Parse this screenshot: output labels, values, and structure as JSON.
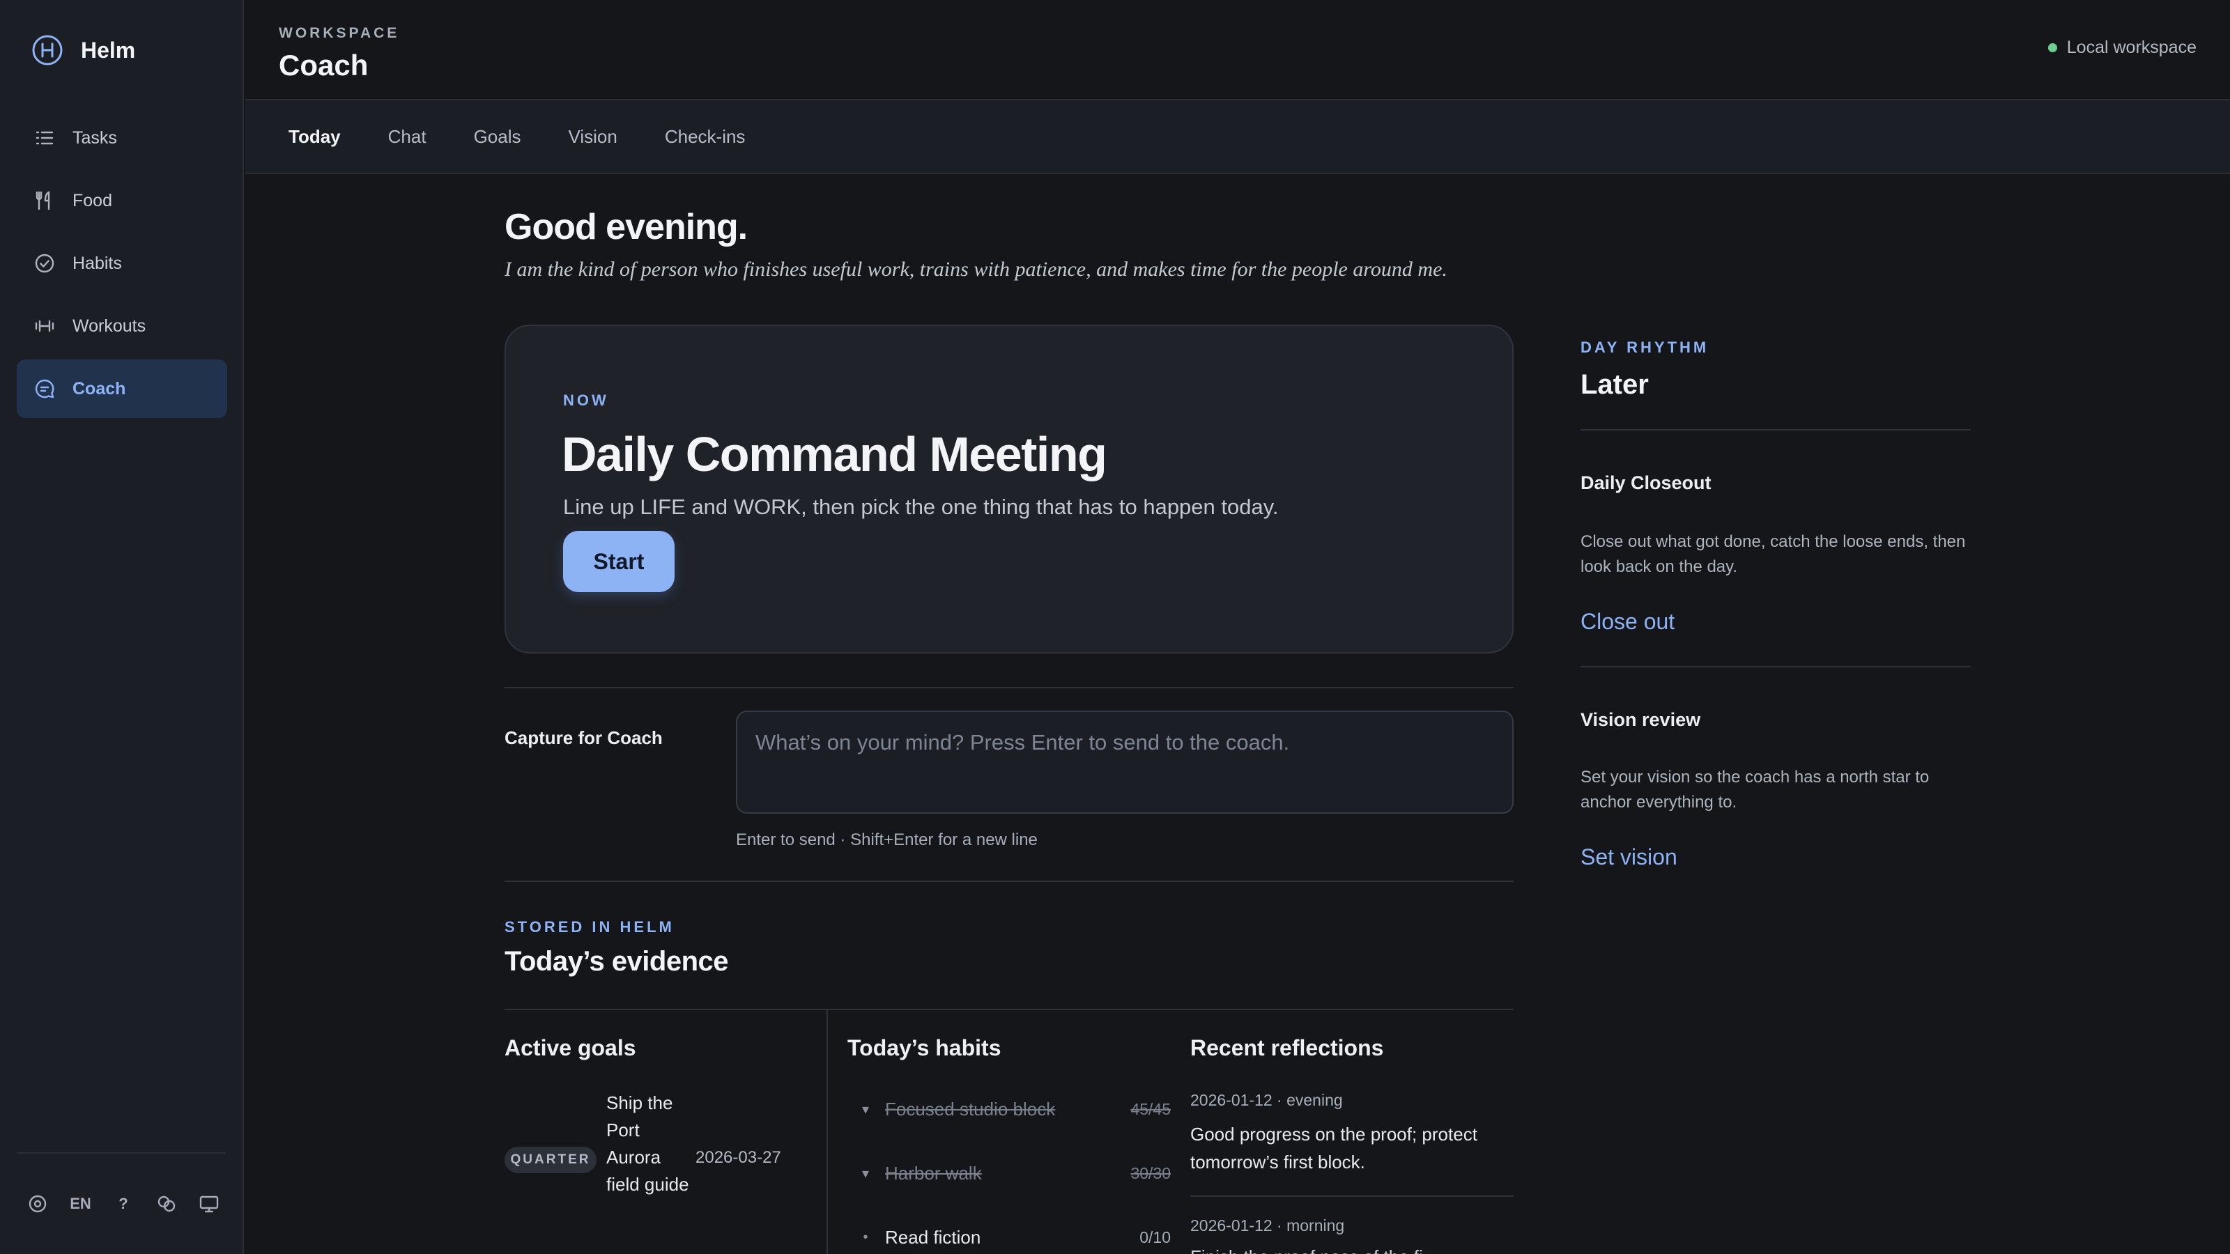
{
  "app": {
    "name": "Helm"
  },
  "sidebar": {
    "items": [
      {
        "label": "Tasks",
        "icon": "list-icon"
      },
      {
        "label": "Food",
        "icon": "fork-knife-icon"
      },
      {
        "label": "Habits",
        "icon": "check-circle-icon"
      },
      {
        "label": "Workouts",
        "icon": "dumbbell-icon"
      },
      {
        "label": "Coach",
        "icon": "chat-bubble-icon",
        "active": true
      }
    ],
    "footer": {
      "language": "EN",
      "help": "?"
    }
  },
  "header": {
    "eyebrow": "WORKSPACE",
    "title": "Coach",
    "status": "Local workspace",
    "status_color": "#6fcf8f"
  },
  "tabs": [
    {
      "label": "Today",
      "active": true
    },
    {
      "label": "Chat"
    },
    {
      "label": "Goals"
    },
    {
      "label": "Vision"
    },
    {
      "label": "Check-ins"
    }
  ],
  "greeting": {
    "title": "Good evening.",
    "identity": "I am the kind of person who finishes useful work, trains with patience, and makes time for the people around me."
  },
  "now": {
    "eyebrow": "NOW",
    "title": "Daily Command Meeting",
    "subtitle": "Line up LIFE and WORK, then pick the one thing that has to happen today.",
    "button": "Start"
  },
  "capture": {
    "label": "Capture for Coach",
    "placeholder": "What’s on your mind? Press Enter to send to the coach.",
    "value": "",
    "hint": "Enter to send · Shift+Enter for a new line"
  },
  "evidence": {
    "eyebrow": "STORED IN HELM",
    "title": "Today’s evidence",
    "goals": {
      "title": "Active goals",
      "items": [
        {
          "badge": "QUARTER",
          "title": "Ship the Port Aurora field guide",
          "date": "2026-03-27"
        }
      ]
    },
    "habits": {
      "title": "Today’s habits",
      "items": [
        {
          "name": "Focused studio block",
          "count": "45/45",
          "done": true
        },
        {
          "name": "Harbor walk",
          "count": "30/30",
          "done": true
        },
        {
          "name": "Read fiction",
          "count": "0/10",
          "done": false
        }
      ]
    },
    "reflections": {
      "title": "Recent reflections",
      "items": [
        {
          "meta": "2026-01-12 · evening",
          "text": "Good progress on the proof; protect tomorrow’s first block."
        },
        {
          "meta": "2026-01-12 · morning",
          "text": "Finish the proof pass of the fi..."
        }
      ]
    }
  },
  "rhythm": {
    "eyebrow": "DAY RHYTHM",
    "title": "Later",
    "cards": [
      {
        "title": "Daily Closeout",
        "body": "Close out what got done, catch the loose ends, then look back on the day.",
        "link": "Close out"
      },
      {
        "title": "Vision review",
        "body": "Set your vision so the coach has a north star to anchor everything to.",
        "link": "Set vision"
      }
    ]
  },
  "colors": {
    "accent": "#8db3f5",
    "background": "#14161a",
    "sidebar": "#1b1e24",
    "active_nav": "#21324d"
  }
}
